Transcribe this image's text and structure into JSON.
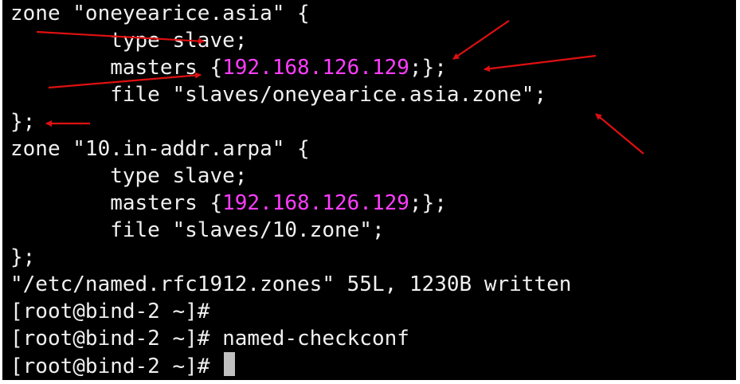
{
  "terminal": {
    "lines": [
      {
        "text": "zone \"oneyearice.asia\" {"
      },
      {
        "before": "        type slave;"
      },
      {
        "before": "        masters {",
        "ip": "192.168.126.129",
        "after": ";};"
      },
      {
        "before": "        file \"slaves/oneyearice.asia.zone\";"
      },
      {
        "text": "};"
      },
      {
        "text": "zone \"10.in-addr.arpa\" {"
      },
      {
        "before": "        type slave;"
      },
      {
        "before": "        masters {",
        "ip": "192.168.126.129",
        "after": ";};"
      },
      {
        "before": "        file \"slaves/10.zone\";"
      },
      {
        "text": "};"
      },
      {
        "text": "\"/etc/named.rfc1912.zones\" 55L, 1230B written"
      },
      {
        "text": "[root@bind-2 ~]#"
      },
      {
        "text": "[root@bind-2 ~]# named-checkconf"
      },
      {
        "text": "[root@bind-2 ~]# "
      }
    ]
  },
  "colors": {
    "background": "#000000",
    "text": "#f0f0f0",
    "ip_highlight": "#ff3dff",
    "annotation_arrow": "#e01010",
    "cursor": "#c0c0c0"
  }
}
